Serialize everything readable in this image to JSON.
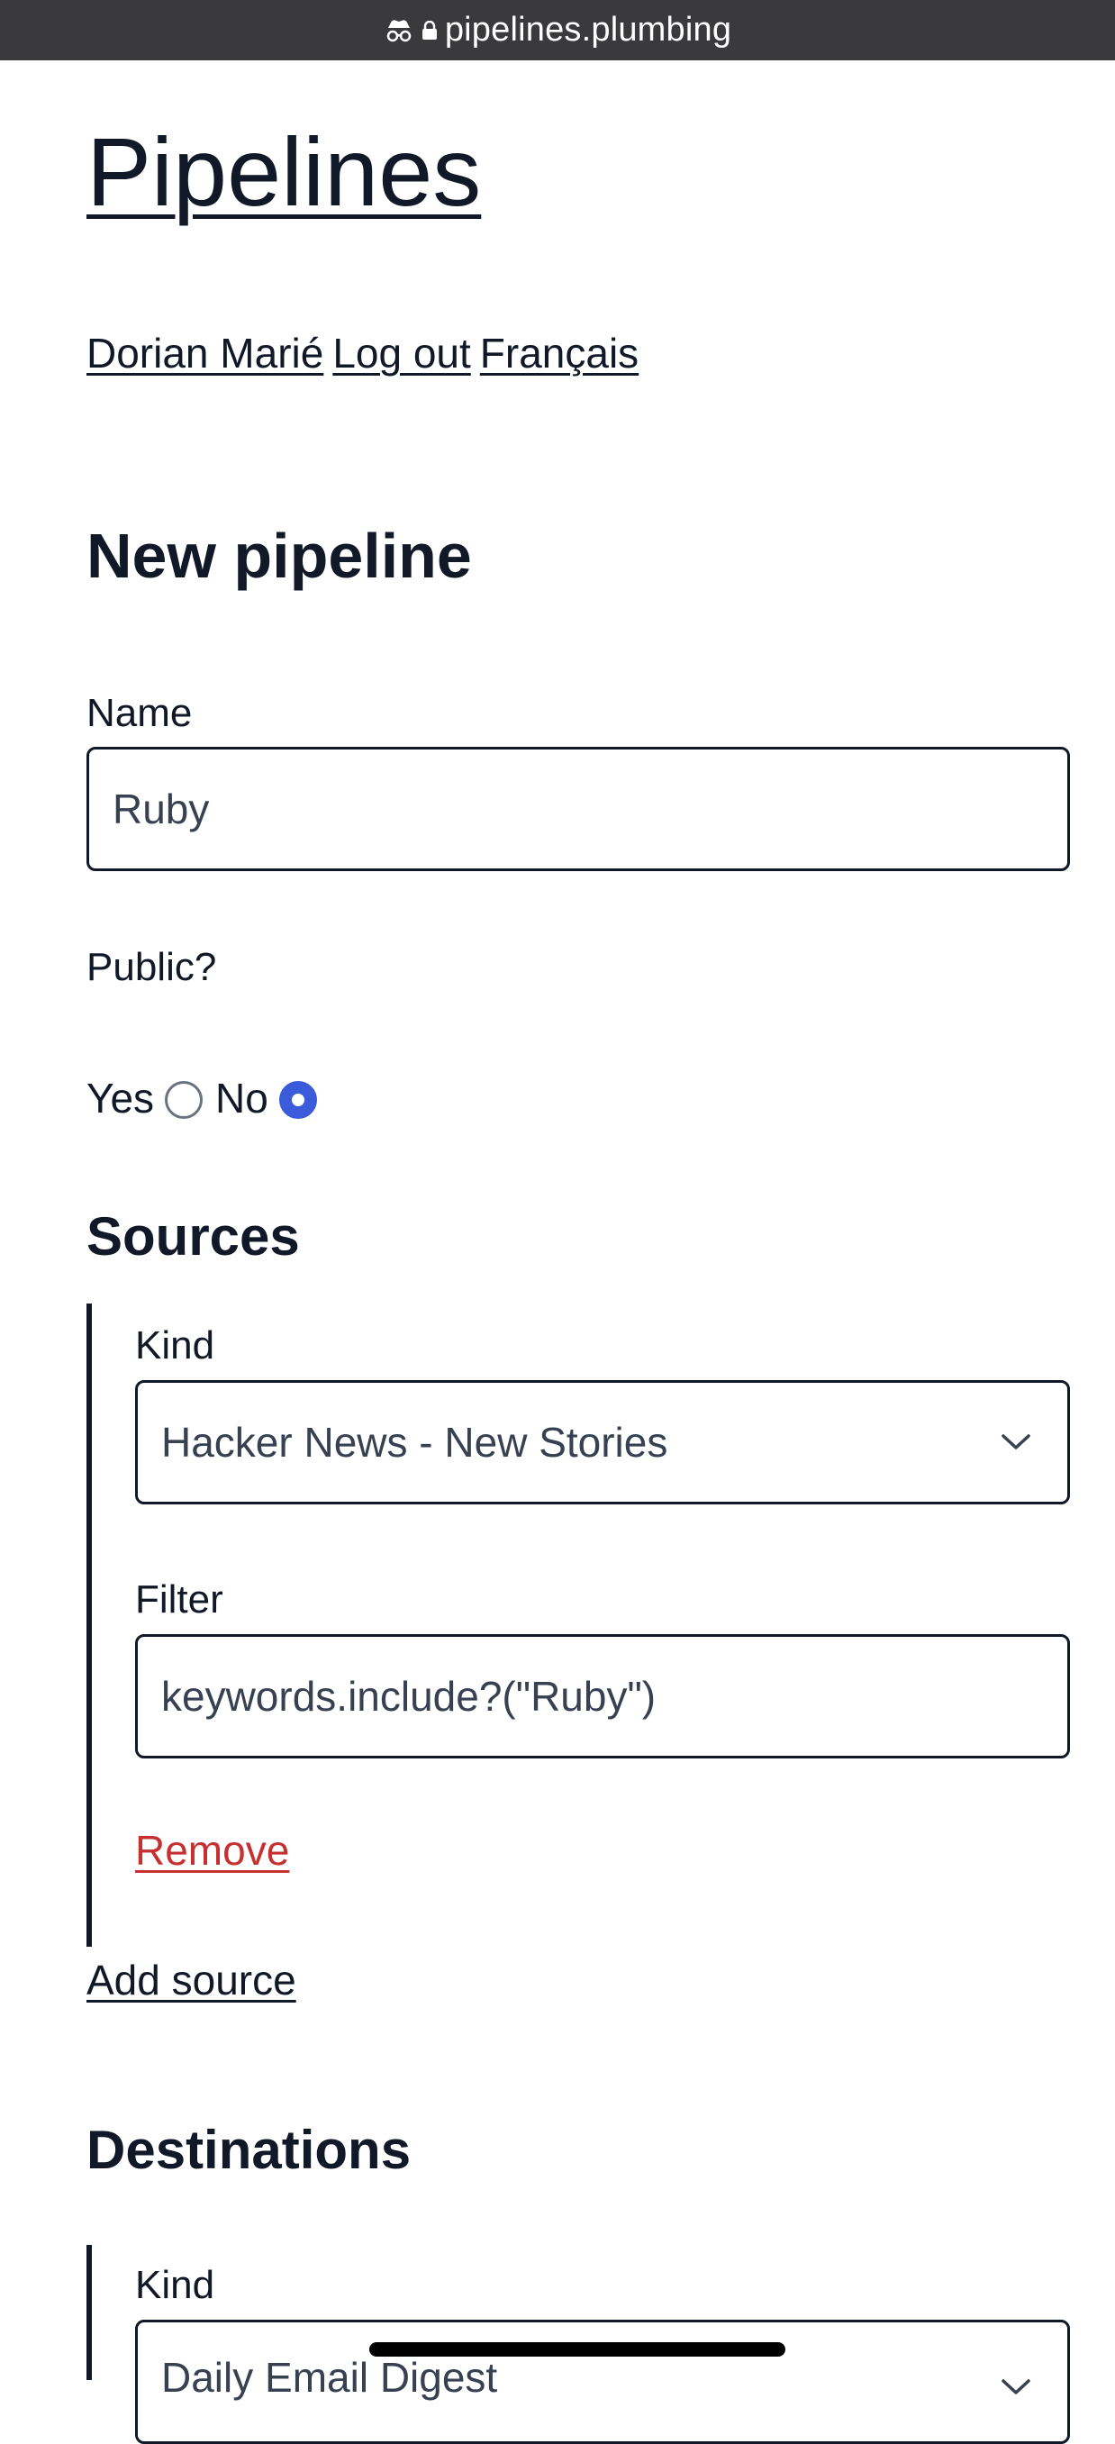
{
  "browser": {
    "url": "pipelines.plumbing"
  },
  "site": {
    "title": "Pipelines"
  },
  "nav": {
    "user": "Dorian Marié",
    "logout": "Log out",
    "language": "Français"
  },
  "form": {
    "heading": "New pipeline",
    "name_label": "Name",
    "name_value": "Ruby",
    "public_label": "Public?",
    "public_options": [
      {
        "label": "Yes",
        "checked": false
      },
      {
        "label": "No",
        "checked": true
      }
    ]
  },
  "sources": {
    "heading": "Sources",
    "items": [
      {
        "kind_label": "Kind",
        "kind_value": "Hacker News - New Stories",
        "filter_label": "Filter",
        "filter_value": "keywords.include?(\"Ruby\")",
        "remove_label": "Remove"
      }
    ],
    "add_label": "Add source"
  },
  "destinations": {
    "heading": "Destinations",
    "items": [
      {
        "kind_label": "Kind",
        "kind_value": "Daily Email Digest"
      }
    ]
  },
  "colors": {
    "accent": "#3b5bdb",
    "danger": "#c53030",
    "text": "#111827"
  }
}
